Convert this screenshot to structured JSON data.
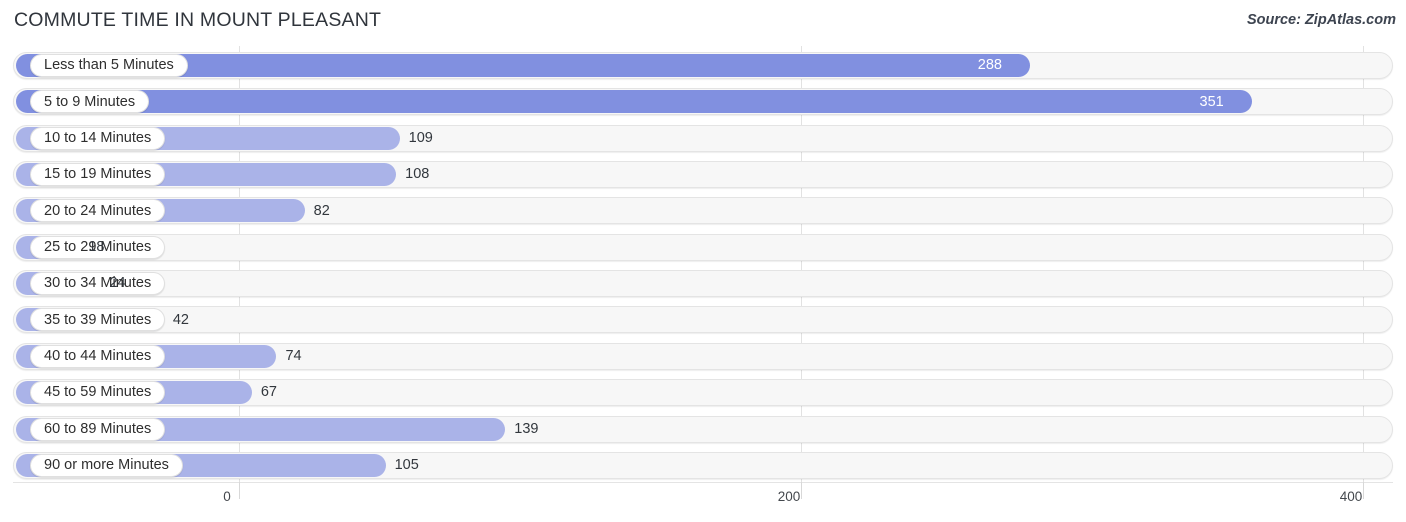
{
  "header": {
    "title": "COMMUTE TIME IN MOUNT PLEASANT",
    "source": "Source: ZipAtlas.com"
  },
  "colors": {
    "bar_strong": "#8190e0",
    "bar_light": "#aab3e8",
    "track": "#f7f7f7",
    "track_border": "#e4e4e4",
    "gridline": "#e2e2e2",
    "label_text": "#2e2e2e",
    "value_text_outside": "#32373d",
    "value_text_inside": "#ffffff"
  },
  "chart_data": {
    "type": "bar",
    "orientation": "horizontal",
    "title": "COMMUTE TIME IN MOUNT PLEASANT",
    "source": "Source: ZipAtlas.com",
    "xlabel": "",
    "ylabel": "",
    "xlim": [
      0,
      400
    ],
    "xticks": [
      0,
      200,
      400
    ],
    "xtick_labels": [
      "0",
      "200",
      "400"
    ],
    "grid": true,
    "legend": false,
    "categories": [
      "Less than 5 Minutes",
      "5 to 9 Minutes",
      "10 to 14 Minutes",
      "15 to 19 Minutes",
      "20 to 24 Minutes",
      "25 to 29 Minutes",
      "30 to 34 Minutes",
      "35 to 39 Minutes",
      "40 to 44 Minutes",
      "45 to 59 Minutes",
      "60 to 89 Minutes",
      "90 or more Minutes"
    ],
    "values": [
      288,
      351,
      109,
      108,
      82,
      18,
      24,
      42,
      74,
      67,
      139,
      105
    ],
    "value_labels": [
      "288",
      "351",
      "109",
      "108",
      "82",
      "18",
      "24",
      "42",
      "74",
      "67",
      "139",
      "105"
    ],
    "label_position": [
      "inside",
      "inside",
      "outside",
      "outside",
      "outside",
      "outside",
      "outside",
      "outside",
      "outside",
      "outside",
      "outside",
      "outside"
    ]
  }
}
